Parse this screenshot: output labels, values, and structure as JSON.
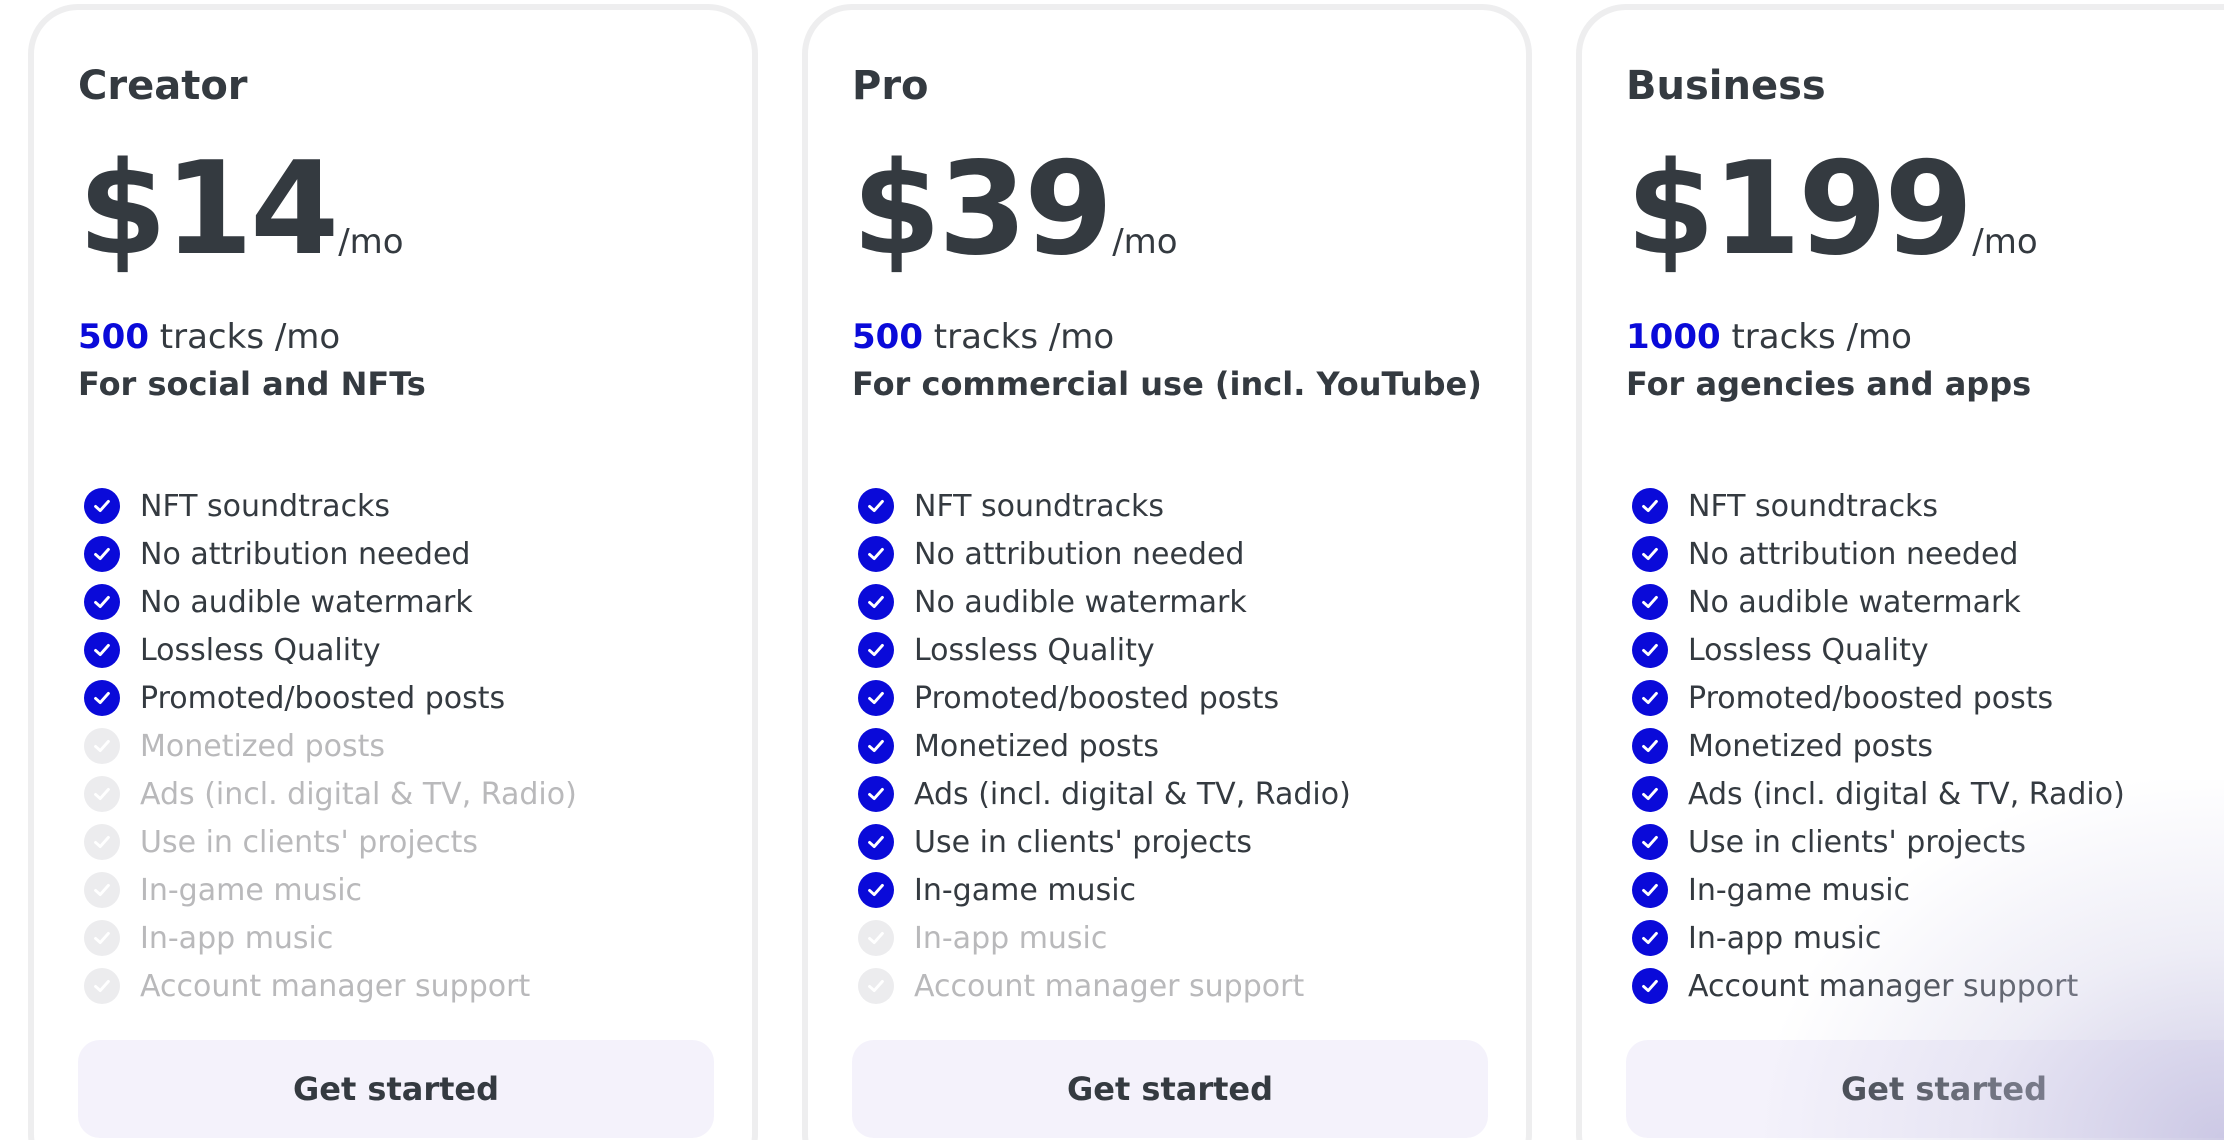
{
  "plans": [
    {
      "name": "Creator",
      "price": "$14",
      "period": "/mo",
      "tracks_count": "500",
      "tracks_suffix": " tracks /mo",
      "audience": "For social and NFTs",
      "features": [
        {
          "label": "NFT soundtracks",
          "included": true
        },
        {
          "label": "No attribution needed",
          "included": true
        },
        {
          "label": "No audible watermark",
          "included": true
        },
        {
          "label": "Lossless Quality",
          "included": true
        },
        {
          "label": "Promoted/boosted posts",
          "included": true
        },
        {
          "label": "Monetized posts",
          "included": false
        },
        {
          "label": "Ads (incl. digital & TV, Radio)",
          "included": false
        },
        {
          "label": "Use in clients' projects",
          "included": false
        },
        {
          "label": "In-game music",
          "included": false
        },
        {
          "label": "In-app music",
          "included": false
        },
        {
          "label": "Account manager support",
          "included": false
        }
      ],
      "cta_label": "Get started"
    },
    {
      "name": "Pro",
      "price": "$39",
      "period": "/mo",
      "tracks_count": "500",
      "tracks_suffix": " tracks /mo",
      "audience": "For commercial use (incl. YouTube)",
      "features": [
        {
          "label": "NFT soundtracks",
          "included": true
        },
        {
          "label": "No attribution needed",
          "included": true
        },
        {
          "label": "No audible watermark",
          "included": true
        },
        {
          "label": "Lossless Quality",
          "included": true
        },
        {
          "label": "Promoted/boosted posts",
          "included": true
        },
        {
          "label": "Monetized posts",
          "included": true
        },
        {
          "label": "Ads (incl. digital & TV, Radio)",
          "included": true
        },
        {
          "label": "Use in clients' projects",
          "included": true
        },
        {
          "label": "In-game music",
          "included": true
        },
        {
          "label": "In-app music",
          "included": false
        },
        {
          "label": "Account manager support",
          "included": false
        }
      ],
      "cta_label": "Get started"
    },
    {
      "name": "Business",
      "price": "$199",
      "period": "/mo",
      "tracks_count": "1000",
      "tracks_suffix": " tracks /mo",
      "audience": "For agencies and apps",
      "features": [
        {
          "label": "NFT soundtracks",
          "included": true
        },
        {
          "label": "No attribution needed",
          "included": true
        },
        {
          "label": "No audible watermark",
          "included": true
        },
        {
          "label": "Lossless Quality",
          "included": true
        },
        {
          "label": "Promoted/boosted posts",
          "included": true
        },
        {
          "label": "Monetized posts",
          "included": true
        },
        {
          "label": "Ads (incl. digital & TV, Radio)",
          "included": true
        },
        {
          "label": "Use in clients' projects",
          "included": true
        },
        {
          "label": "In-game music",
          "included": true
        },
        {
          "label": "In-app music",
          "included": true
        },
        {
          "label": "Account manager support",
          "included": true
        }
      ],
      "cta_label": "Get started"
    }
  ],
  "colors": {
    "accent": "#0a0ad9",
    "text": "#343a40",
    "disabled_text": "#b9b9bb",
    "button_background": "#f4f2fb",
    "card_border": "#eeeeef"
  },
  "icons": {
    "included": "check-circle-icon",
    "excluded": "check-circle-disabled-icon"
  }
}
